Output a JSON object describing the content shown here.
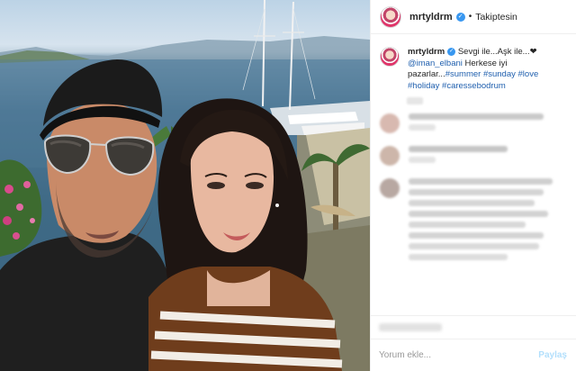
{
  "post": {
    "username": "mrtyldrm",
    "verified": true,
    "follow_status": "Takiptesin",
    "separator": "•"
  },
  "caption": {
    "username": "mrtyldrm",
    "text_1": " Sevgi ile...Aşk ile...",
    "heart": "❤",
    "mention": "@iman_elbani",
    "text_2": " Herkese iyi pazarlar...",
    "hashtags": [
      "#summer",
      "#sunday",
      "#love",
      "#holiday",
      "#caressebodrum"
    ]
  },
  "comment_box": {
    "placeholder": "Yorum ekle...",
    "post_label": "Paylaş"
  },
  "colors": {
    "verified_badge": "#3897f0",
    "link": "#1f5fae",
    "post_button_disabled": "#b2dffc",
    "divider": "#efefef"
  },
  "icons": {
    "verified": "verified-badge-icon",
    "heart": "heart-emoji-icon"
  }
}
